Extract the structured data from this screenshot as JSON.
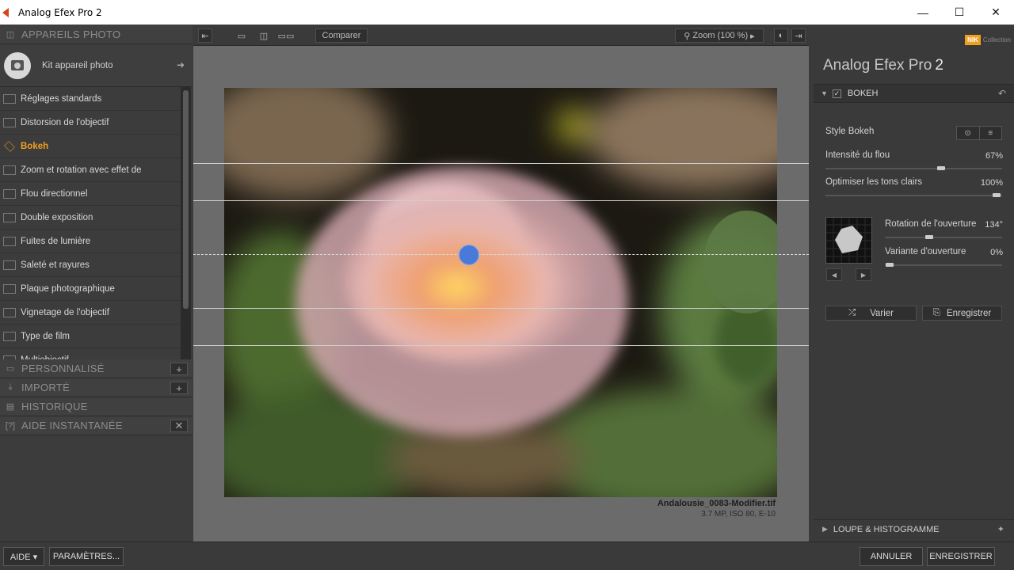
{
  "window": {
    "title": "Analog Efex Pro 2",
    "minimize": "—",
    "maximize": "☐",
    "close": "✕"
  },
  "left": {
    "cameras_header": "APPAREILS PHOTO",
    "kit_label": "Kit appareil photo",
    "filters": [
      {
        "label": "Réglages standards",
        "active": false
      },
      {
        "label": "Distorsion de l'objectif",
        "active": false
      },
      {
        "label": "Bokeh",
        "active": true
      },
      {
        "label": "Zoom et rotation avec effet de",
        "active": false
      },
      {
        "label": "Flou directionnel",
        "active": false
      },
      {
        "label": "Double exposition",
        "active": false
      },
      {
        "label": "Fuites de lumière",
        "active": false
      },
      {
        "label": "Saleté et rayures",
        "active": false
      },
      {
        "label": "Plaque photographique",
        "active": false
      },
      {
        "label": "Vignetage de l'objectif",
        "active": false
      },
      {
        "label": "Type de film",
        "active": false
      },
      {
        "label": "Multiobjectif",
        "active": false
      }
    ],
    "sections": {
      "custom": "PERSONNALISÉ",
      "imported": "IMPORTÉ",
      "history": "HISTORIQUE",
      "help": "AIDE INSTANTANÉE"
    }
  },
  "toolbar": {
    "compare_label": "Comparer",
    "zoom_label": "Zoom (100 %)"
  },
  "image": {
    "filename": "Andalousie_0083-Modifier.tif",
    "meta": "3.7 MP, ISO 80, E-10"
  },
  "right": {
    "brand_logo": "NIK",
    "brand_sub": "Collection",
    "app_name": "Analog Efex Pro",
    "app_version": "2",
    "filter_name": "BOKEH",
    "style_label": "Style Bokeh",
    "blur_label": "Intensité du flou",
    "blur_value": "67%",
    "highlights_label": "Optimiser les tons clairs",
    "highlights_value": "100%",
    "rotation_label": "Rotation de l'ouverture",
    "rotation_value": "134°",
    "variant_label": "Variante d'ouverture",
    "variant_value": "0%",
    "vary_label": "Varier",
    "save_label": "Enregistrer",
    "loupe_label": "LOUPE & HISTOGRAMME"
  },
  "bottom": {
    "help_label": "AIDE ▾",
    "settings_label": "PARAMÈTRES...",
    "cancel_label": "ANNULER",
    "save_label": "ENREGISTRER"
  },
  "colors": {
    "accent": "#f0a020",
    "handle": "#4a7ad8"
  }
}
